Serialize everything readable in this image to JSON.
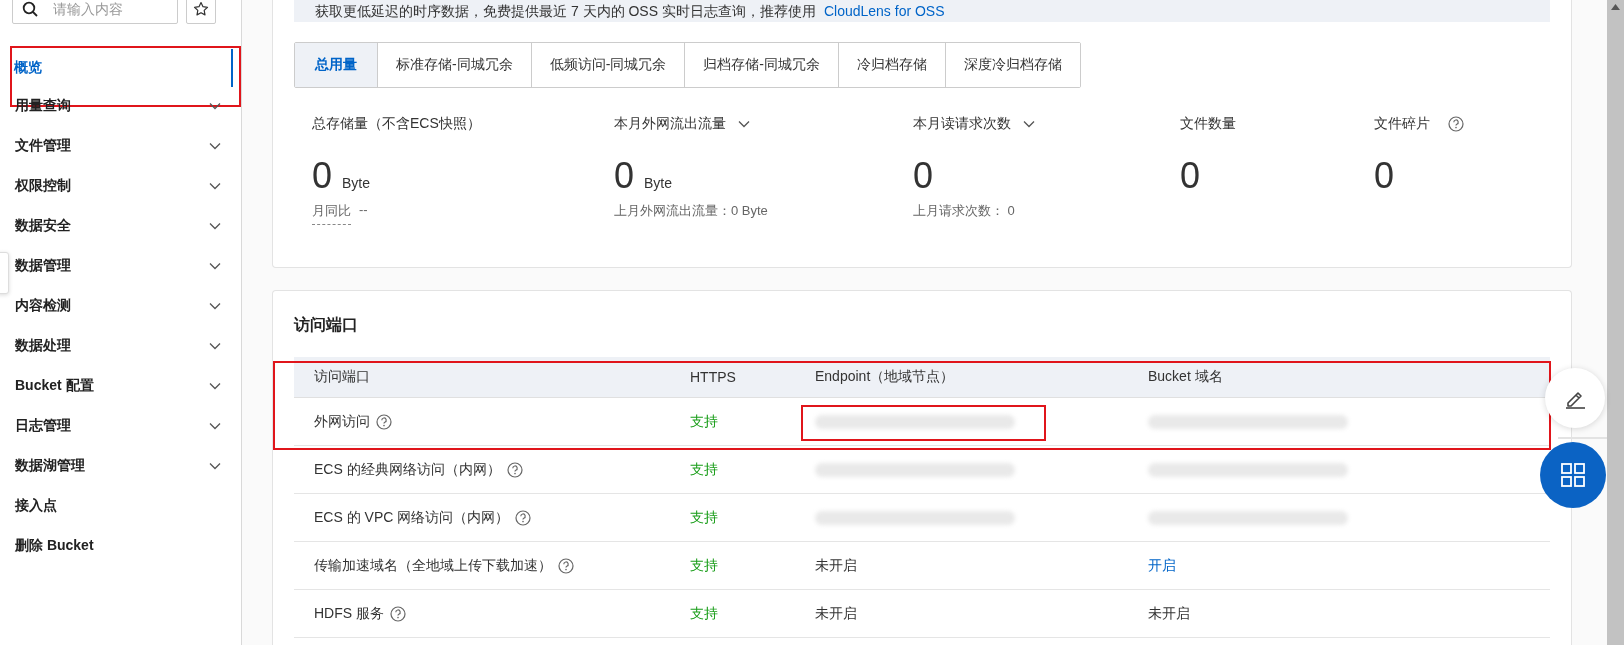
{
  "sidebar": {
    "search": {
      "placeholder": "请输入内容"
    },
    "items": [
      {
        "label": "概览",
        "selected": true,
        "expandable": false,
        "highlighted": true
      },
      {
        "label": "用量查询",
        "selected": false,
        "expandable": true,
        "highlighted": false
      },
      {
        "label": "文件管理",
        "selected": false,
        "expandable": true,
        "highlighted": false
      },
      {
        "label": "权限控制",
        "selected": false,
        "expandable": true,
        "highlighted": false
      },
      {
        "label": "数据安全",
        "selected": false,
        "expandable": true,
        "highlighted": false
      },
      {
        "label": "数据管理",
        "selected": false,
        "expandable": true,
        "highlighted": false
      },
      {
        "label": "内容检测",
        "selected": false,
        "expandable": true,
        "highlighted": false
      },
      {
        "label": "数据处理",
        "selected": false,
        "expandable": true,
        "highlighted": false
      },
      {
        "label": "Bucket 配置",
        "selected": false,
        "expandable": true,
        "highlighted": false
      },
      {
        "label": "日志管理",
        "selected": false,
        "expandable": true,
        "highlighted": false
      },
      {
        "label": "数据湖管理",
        "selected": false,
        "expandable": true,
        "highlighted": false
      },
      {
        "label": "接入点",
        "selected": false,
        "expandable": false,
        "highlighted": false
      },
      {
        "label": "删除 Bucket",
        "selected": false,
        "expandable": false,
        "highlighted": false
      }
    ]
  },
  "banner": {
    "text": "获取更低延迟的时序数据，免费提供最近 7 天内的 OSS 实时日志查询，推荐使用",
    "link": "CloudLens for OSS"
  },
  "storage_tabs": [
    {
      "label": "总用量",
      "selected": true
    },
    {
      "label": "标准存储-同城冗余",
      "selected": false
    },
    {
      "label": "低频访问-同城冗余",
      "selected": false
    },
    {
      "label": "归档存储-同城冗余",
      "selected": false
    },
    {
      "label": "冷归档存储",
      "selected": false
    },
    {
      "label": "深度冷归档存储",
      "selected": false
    }
  ],
  "stats": [
    {
      "label": "总存储量（不含ECS快照）",
      "value": "0",
      "unit": "Byte",
      "dropdown": false,
      "help": false,
      "comparison": {
        "label": "月同比",
        "value": "--"
      }
    },
    {
      "label": "本月外网流出流量",
      "value": "0",
      "unit": "Byte",
      "dropdown": true,
      "help": false,
      "note": "上月外网流出流量：0 Byte"
    },
    {
      "label": "本月读请求次数",
      "value": "0",
      "dropdown": true,
      "help": false,
      "note": "上月请求次数：  0"
    },
    {
      "label": "文件数量",
      "value": "0",
      "dropdown": false,
      "help": false
    },
    {
      "label": "文件碎片",
      "value": "0",
      "dropdown": false,
      "help": true
    }
  ],
  "access_section": {
    "title": "访问端口",
    "header_highlighted": true,
    "columns": [
      "访问端口",
      "HTTPS",
      "Endpoint（地域节点）",
      "Bucket 域名"
    ],
    "rows": [
      {
        "name": "外网访问",
        "help": true,
        "https": "支持",
        "highlighted": true,
        "endpoint": {
          "kind": "redacted",
          "highlighted": true
        },
        "bucket_domain": {
          "kind": "redacted",
          "highlighted": false
        }
      },
      {
        "name": "ECS 的经典网络访问（内网）",
        "help": true,
        "https": "支持",
        "highlighted": false,
        "endpoint": {
          "kind": "redacted",
          "highlighted": false
        },
        "bucket_domain": {
          "kind": "redacted",
          "highlighted": false
        }
      },
      {
        "name": "ECS 的 VPC 网络访问（内网）",
        "help": true,
        "https": "支持",
        "highlighted": false,
        "endpoint": {
          "kind": "redacted",
          "highlighted": false
        },
        "bucket_domain": {
          "kind": "redacted",
          "highlighted": false
        }
      },
      {
        "name": "传输加速域名（全地域上传下载加速）",
        "help": true,
        "https": "支持",
        "highlighted": false,
        "endpoint": {
          "kind": "text",
          "text": "未开启",
          "highlighted": false
        },
        "bucket_domain": {
          "kind": "link",
          "text": "开启",
          "highlighted": false
        }
      },
      {
        "name": "HDFS 服务",
        "help": true,
        "https": "支持",
        "highlighted": false,
        "endpoint": {
          "kind": "text",
          "text": "未开启",
          "highlighted": false
        },
        "bucket_domain": {
          "kind": "text",
          "text": "未开启",
          "highlighted": false
        }
      }
    ]
  }
}
